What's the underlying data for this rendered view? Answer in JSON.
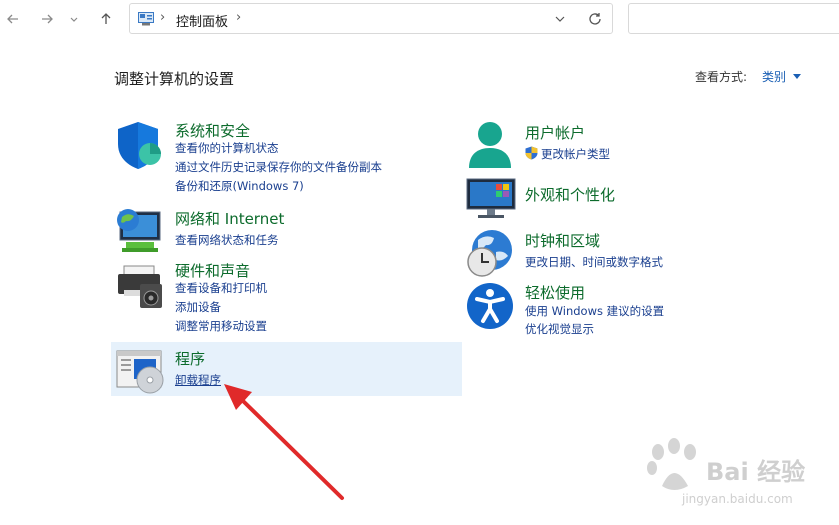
{
  "address_bar": {
    "separator": "›",
    "breadcrumb": "控制面板",
    "trailing_separator": "›"
  },
  "page": {
    "title": "调整计算机的设置",
    "view_by_label": "查看方式:",
    "view_by_value": "类别"
  },
  "left_categories": [
    {
      "icon": "security-shield-icon",
      "title": "系统和安全",
      "links": [
        "查看你的计算机状态",
        "通过文件历史记录保存你的文件备份副本",
        "备份和还原(Windows 7)"
      ]
    },
    {
      "icon": "network-globe-icon",
      "title": "网络和 Internet",
      "links": [
        "查看网络状态和任务"
      ]
    },
    {
      "icon": "printer-icon",
      "title": "硬件和声音",
      "links": [
        "查看设备和打印机",
        "添加设备",
        "调整常用移动设置"
      ]
    },
    {
      "icon": "programs-disc-icon",
      "title": "程序",
      "links": [
        "卸载程序"
      ]
    }
  ],
  "right_categories": [
    {
      "icon": "user-accounts-icon",
      "title": "用户帐户",
      "links": [
        "更改帐户类型"
      ]
    },
    {
      "icon": "appearance-monitor-icon",
      "title": "外观和个性化",
      "links": []
    },
    {
      "icon": "clock-globe-icon",
      "title": "时钟和区域",
      "links": [
        "更改日期、时间或数字格式"
      ]
    },
    {
      "icon": "accessibility-icon",
      "title": "轻松使用",
      "links": [
        "使用 Windows 建议的设置",
        "优化视觉显示"
      ]
    }
  ],
  "watermark": {
    "brand": "Bai 经验",
    "url": "jingyan.baidu.com"
  },
  "colors": {
    "category_title": "#0c6b2c",
    "link": "#1a3f8f",
    "highlight": "#e6f1fb",
    "annotation_arrow": "#e02a2a"
  }
}
